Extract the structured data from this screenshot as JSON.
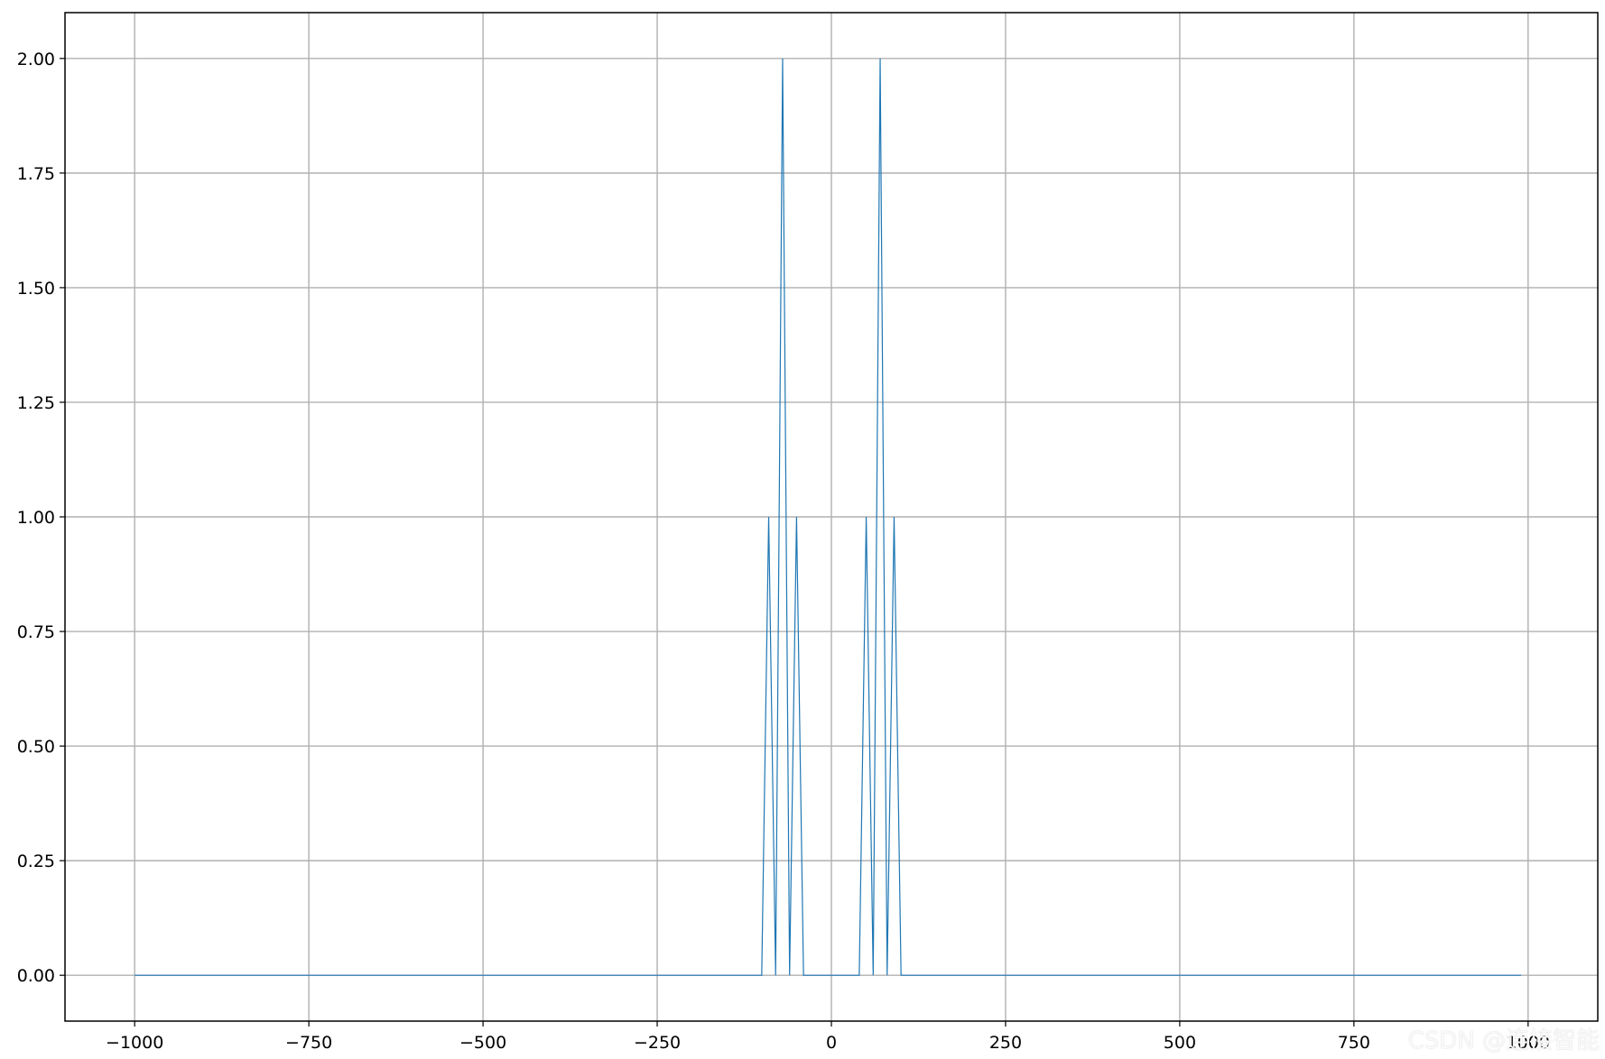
{
  "chart_data": {
    "type": "line",
    "title": "",
    "xlabel": "",
    "ylabel": "",
    "grid": true,
    "xlim": [
      -1100,
      1100
    ],
    "ylim": [
      -0.1,
      2.1
    ],
    "xticks": [
      -1000,
      -750,
      -500,
      -250,
      0,
      250,
      500,
      750,
      1000
    ],
    "xtick_labels": [
      "−1000",
      "−750",
      "−500",
      "−250",
      "0",
      "250",
      "500",
      "750",
      "1000"
    ],
    "yticks": [
      0,
      0.25,
      0.5,
      0.75,
      1.0,
      1.25,
      1.5,
      1.75,
      2.0
    ],
    "ytick_labels": [
      "0.00",
      "0.25",
      "0.50",
      "0.75",
      "1.00",
      "1.25",
      "1.50",
      "1.75",
      "2.00"
    ],
    "series": [
      {
        "color": "#1f77b4",
        "x": [
          -1000,
          -100,
          -90,
          -80,
          -70,
          -60,
          -50,
          -40,
          -10,
          40,
          50,
          60,
          70,
          80,
          90,
          100,
          990
        ],
        "y": [
          0,
          0,
          1,
          0,
          2,
          0,
          1,
          0,
          0,
          0,
          1,
          0,
          2,
          0,
          1,
          0,
          0
        ]
      }
    ]
  },
  "watermark": "CSDN @连接智能"
}
